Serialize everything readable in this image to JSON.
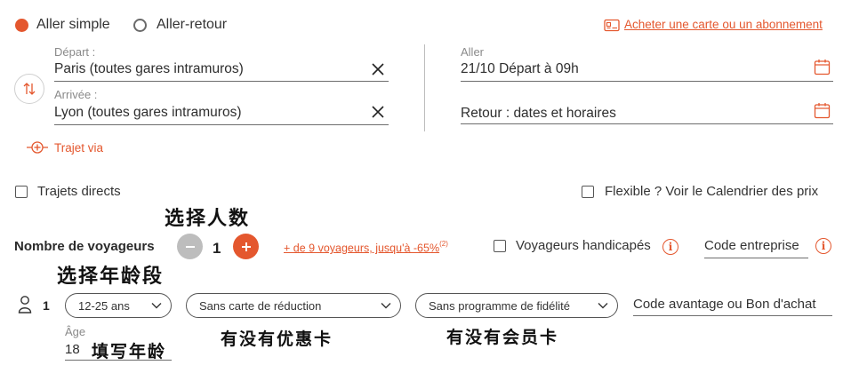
{
  "trip_type": {
    "one_way": "Aller simple",
    "round_trip": "Aller-retour",
    "selected": "one_way"
  },
  "card_link": "Acheter une carte ou un abonnement",
  "departure": {
    "label": "Départ :",
    "value": "Paris (toutes gares intramuros)"
  },
  "arrival": {
    "label": "Arrivée :",
    "value": "Lyon (toutes gares intramuros)"
  },
  "outbound": {
    "label": "Aller",
    "value": "21/10 Départ à 09h"
  },
  "return_trip": {
    "value": "Retour : dates et horaires"
  },
  "via_link": "Trajet via",
  "direct_trips": {
    "label": "Trajets directs",
    "checked": false
  },
  "flexible": {
    "label": "Flexible ? Voir le Calendrier des prix",
    "checked": false
  },
  "travelers": {
    "label": "Nombre de voyageurs",
    "count": "1",
    "more_link": "+ de 9 voyageurs, jusqu'à -65%",
    "more_sup": "(2)",
    "handicap_label": "Voyageurs handicapés",
    "company_code": "Code entreprise"
  },
  "passenger": {
    "index": "1",
    "age_range": "12-25 ans",
    "reduction": "Sans carte de réduction",
    "loyalty": "Sans programme de fidélité",
    "promo_code": "Code avantage ou Bon d'achat",
    "age_label": "Âge",
    "age_value": "18"
  },
  "annotations": {
    "choose_count": "选择人数",
    "choose_age": "选择年龄段",
    "discount_card": "有没有优惠卡",
    "member_card": "有没有会员卡",
    "fill_age": "填写年龄"
  },
  "colors": {
    "accent": "#e4572e",
    "text": "#2b2b2b",
    "muted": "#8a8a8a"
  }
}
